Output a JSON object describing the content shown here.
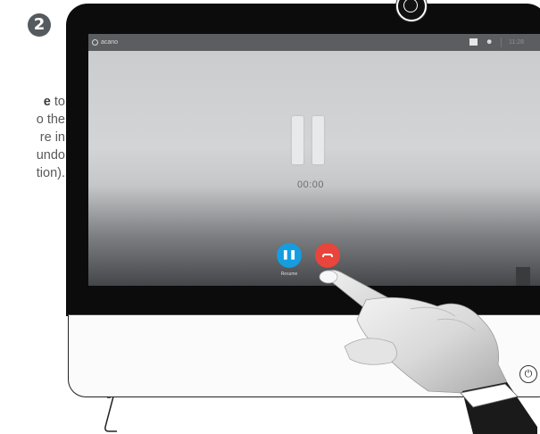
{
  "step": {
    "number": "2"
  },
  "instruction": {
    "line1_bold": "e",
    "line1_rest": " to",
    "line2": "o the",
    "line3": "re in",
    "line4": "undo",
    "line5": "tion)."
  },
  "screen": {
    "brand": "acano",
    "clock": "11:28",
    "timer": "00:00",
    "resume_label": "Resume"
  },
  "icons": {
    "power": "power-icon",
    "pause": "pause-icon",
    "end_call": "end-call-icon"
  },
  "colors": {
    "resume_button": "#159de0",
    "end_button": "#e8453c",
    "step_badge": "#555a5e"
  }
}
